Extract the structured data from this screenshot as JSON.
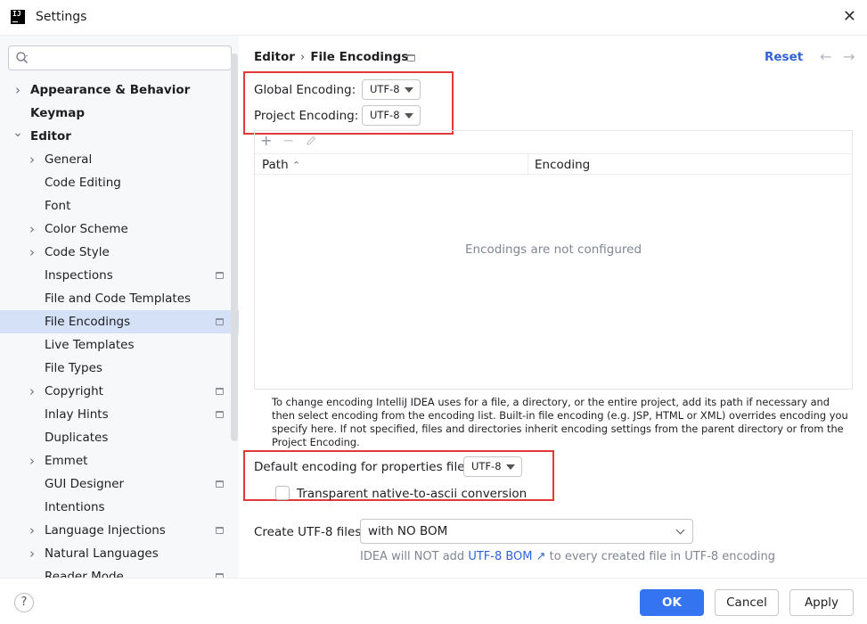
{
  "window": {
    "title": "Settings",
    "app_icon_text": "IJ"
  },
  "search": {
    "placeholder": "",
    "icon": "search-icon"
  },
  "sidebar": {
    "items": [
      {
        "label": "Appearance & Behavior",
        "level": 0,
        "arrow": "right",
        "bold": true
      },
      {
        "label": "Keymap",
        "level": 0,
        "arrow": "",
        "bold": true
      },
      {
        "label": "Editor",
        "level": 0,
        "arrow": "down",
        "bold": true
      },
      {
        "label": "General",
        "level": 1,
        "arrow": "right"
      },
      {
        "label": "Code Editing",
        "level": 1,
        "arrow": ""
      },
      {
        "label": "Font",
        "level": 1,
        "arrow": ""
      },
      {
        "label": "Color Scheme",
        "level": 1,
        "arrow": "right"
      },
      {
        "label": "Code Style",
        "level": 1,
        "arrow": "right"
      },
      {
        "label": "Inspections",
        "level": 1,
        "arrow": "",
        "project_icon": true
      },
      {
        "label": "File and Code Templates",
        "level": 1,
        "arrow": ""
      },
      {
        "label": "File Encodings",
        "level": 1,
        "arrow": "",
        "project_icon": true,
        "selected": true
      },
      {
        "label": "Live Templates",
        "level": 1,
        "arrow": ""
      },
      {
        "label": "File Types",
        "level": 1,
        "arrow": ""
      },
      {
        "label": "Copyright",
        "level": 1,
        "arrow": "right",
        "project_icon": true
      },
      {
        "label": "Inlay Hints",
        "level": 1,
        "arrow": "",
        "project_icon": true
      },
      {
        "label": "Duplicates",
        "level": 1,
        "arrow": ""
      },
      {
        "label": "Emmet",
        "level": 1,
        "arrow": "right"
      },
      {
        "label": "GUI Designer",
        "level": 1,
        "arrow": "",
        "project_icon": true
      },
      {
        "label": "Intentions",
        "level": 1,
        "arrow": ""
      },
      {
        "label": "Language Injections",
        "level": 1,
        "arrow": "right",
        "project_icon": true
      },
      {
        "label": "Natural Languages",
        "level": 1,
        "arrow": "right"
      },
      {
        "label": "Reader Mode",
        "level": 1,
        "arrow": "",
        "project_icon": true
      }
    ]
  },
  "breadcrumb": {
    "parent": "Editor",
    "separator": "›",
    "current": "File Encodings"
  },
  "header": {
    "reset_label": "Reset",
    "back_arrow": "←",
    "forward_arrow": "→"
  },
  "encodings": {
    "global_label": "Global Encoding:",
    "global_value": "UTF-8",
    "project_label": "Project Encoding:",
    "project_value": "UTF-8"
  },
  "table": {
    "add_symbol": "+",
    "remove_symbol": "−",
    "columns": [
      "Path",
      "Encoding"
    ],
    "sort_indicator": "⌃",
    "empty_text": "Encodings are not configured"
  },
  "help_text": "To change encoding IntelliJ IDEA uses for a file, a directory, or the entire project, add its path if necessary and then select encoding from the encoding list. Built-in file encoding (e.g. JSP, HTML or XML) overrides encoding you specify here. If not specified, files and directories inherit encoding settings from the parent directory or from the Project Encoding.",
  "properties": {
    "label": "Default encoding for properties files:",
    "value": "UTF-8",
    "transparent_label": "Transparent native-to-ascii conversion",
    "transparent_checked": false
  },
  "bom": {
    "label": "Create UTF-8 files:",
    "value": "with NO BOM",
    "hint_prefix": "IDEA will NOT add",
    "hint_link": "UTF-8 BOM ↗",
    "hint_suffix": "to every created file in UTF-8 encoding"
  },
  "footer": {
    "help_symbol": "?",
    "ok_label": "OK",
    "cancel_label": "Cancel",
    "apply_label": "Apply"
  },
  "colors": {
    "accent": "#3574f0",
    "link": "#2f64d6",
    "selection": "#d5e1f7",
    "highlight_box": "#e03a3a"
  }
}
